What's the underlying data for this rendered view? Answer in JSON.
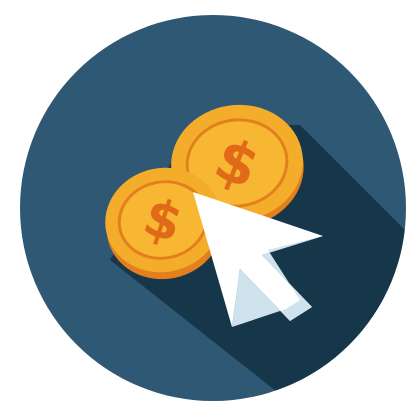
{
  "icon": {
    "name": "pay-per-click-icon",
    "elements": [
      "circle-background-icon",
      "long-shadow-icon",
      "dollar-coin-icon",
      "dollar-coin-icon",
      "mouse-cursor-icon"
    ]
  },
  "colors": {
    "background_circle": "#2f5874",
    "long_shadow": "#16364a",
    "coin_outer": "#f4ad2b",
    "coin_rim": "#e47f1f",
    "coin_face": "#f7b733",
    "dollar_symbol": "#e06a18",
    "cursor_fill": "#ffffff",
    "cursor_shade": "#cfe3ef"
  }
}
